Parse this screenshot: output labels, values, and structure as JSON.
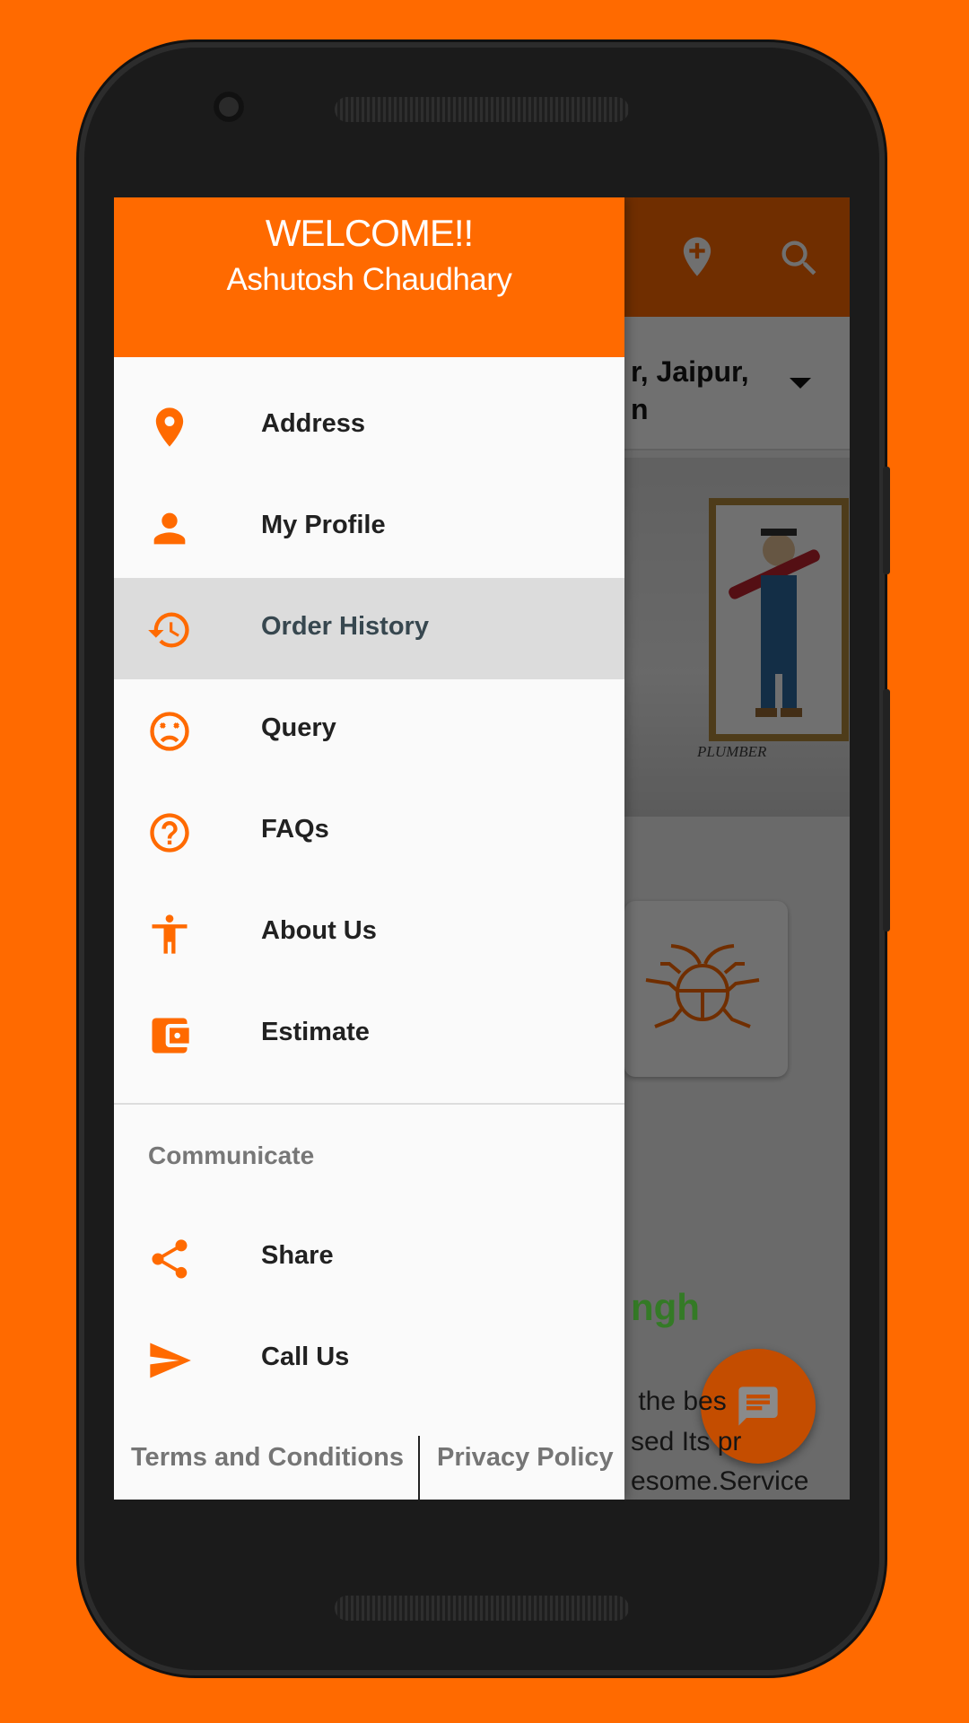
{
  "colors": {
    "brand_orange": "#ff6a00",
    "icon_orange": "#ff6a00",
    "active_item_bg": "#dcdcdc",
    "accent_green": "#3fa535"
  },
  "drawer": {
    "header": {
      "welcome": "WELCOME!!",
      "user_name": "Ashutosh Chaudhary"
    },
    "items": [
      {
        "label": "Address",
        "icon": "location-pin-icon",
        "active": false
      },
      {
        "label": "My Profile",
        "icon": "person-icon",
        "active": false
      },
      {
        "label": "Order History",
        "icon": "history-icon",
        "active": true
      },
      {
        "label": "Query",
        "icon": "sad-face-icon",
        "active": false
      },
      {
        "label": "FAQs",
        "icon": "help-circle-icon",
        "active": false
      },
      {
        "label": "About Us",
        "icon": "accessibility-icon",
        "active": false
      },
      {
        "label": "Estimate",
        "icon": "wallet-icon",
        "active": false
      }
    ],
    "section_header": "Communicate",
    "comm_items": [
      {
        "label": "Share",
        "icon": "share-icon"
      },
      {
        "label": "Call Us",
        "icon": "send-icon"
      }
    ],
    "footer": {
      "terms": "Terms and Conditions",
      "privacy": "Privacy Policy"
    }
  },
  "background": {
    "toolbar_icons": [
      "add-location-icon",
      "search-icon"
    ],
    "address_line1": "r, Jaipur,",
    "address_line2": "n",
    "banner_label": "PLUMBER",
    "service_icon": "bug-icon",
    "name_fragment": "ngh",
    "description_lines": [
      " the bes",
      "sed Its pr",
      "esome.Service"
    ],
    "fab_icon": "chat-icon"
  }
}
